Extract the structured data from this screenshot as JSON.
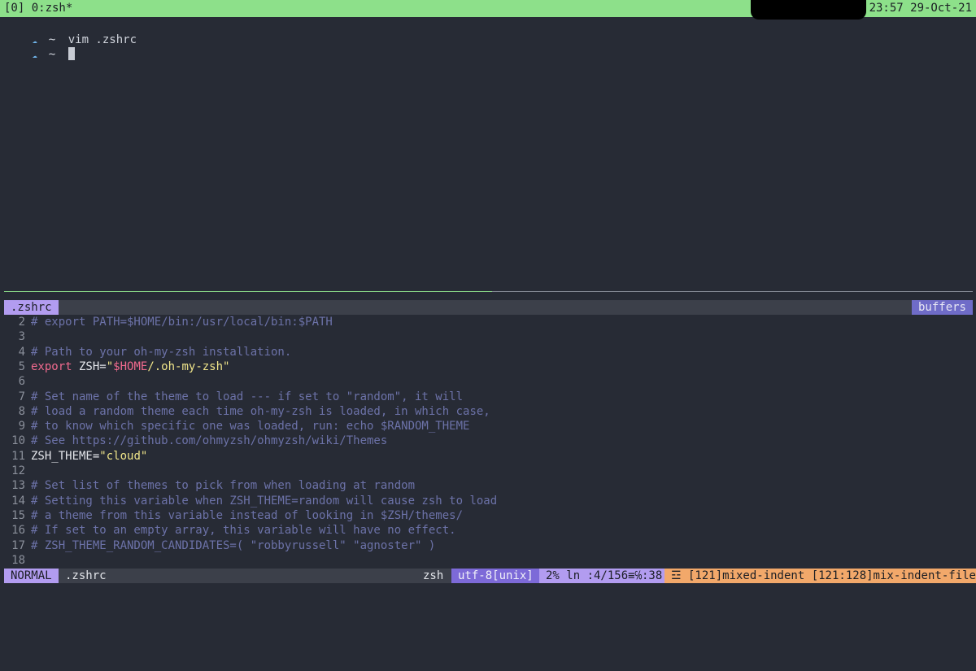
{
  "tmux": {
    "window_label": "[0] 0:zsh*",
    "clock": "23:57 29-Oct-21",
    "colors": {
      "bar": "#8de08a",
      "text": "#1b1e24"
    }
  },
  "shell": {
    "lines": [
      {
        "icon": "cloud-icon",
        "dir": "~",
        "command": "vim .zshrc"
      },
      {
        "icon": "cloud-icon",
        "dir": "~",
        "command": ""
      }
    ]
  },
  "vim": {
    "tabline": {
      "current_tab": ".zshrc",
      "buffers_label": "buffers"
    },
    "lines": [
      {
        "num": "2",
        "segments": [
          {
            "t": "# export PATH=$HOME/bin:/usr/local/bin:$PATH",
            "c": "comment"
          }
        ]
      },
      {
        "num": "3",
        "segments": []
      },
      {
        "num": "4",
        "segments": [
          {
            "t": "# Path to your oh-my-zsh installation.",
            "c": "comment"
          }
        ]
      },
      {
        "num": "5",
        "segments": [
          {
            "t": "export",
            "c": "kw"
          },
          {
            "t": " ZSH=",
            "c": "plain"
          },
          {
            "t": "\"",
            "c": "str"
          },
          {
            "t": "$HOME",
            "c": "var"
          },
          {
            "t": "/.oh-my-zsh\"",
            "c": "str"
          }
        ]
      },
      {
        "num": "6",
        "segments": []
      },
      {
        "num": "7",
        "segments": [
          {
            "t": "# Set name of the theme to load --- if set to \"random\", it will",
            "c": "comment"
          }
        ]
      },
      {
        "num": "8",
        "segments": [
          {
            "t": "# load a random theme each time oh-my-zsh is loaded, in which case,",
            "c": "comment"
          }
        ]
      },
      {
        "num": "9",
        "segments": [
          {
            "t": "# to know which specific one was loaded, run: echo $RANDOM_THEME",
            "c": "comment"
          }
        ]
      },
      {
        "num": "10",
        "segments": [
          {
            "t": "# See https://github.com/ohmyzsh/ohmyzsh/wiki/Themes",
            "c": "comment"
          }
        ]
      },
      {
        "num": "11",
        "segments": [
          {
            "t": "ZSH_THEME=",
            "c": "plain"
          },
          {
            "t": "\"cloud\"",
            "c": "str"
          }
        ]
      },
      {
        "num": "12",
        "segments": []
      },
      {
        "num": "13",
        "segments": [
          {
            "t": "# Set list of themes to pick from when loading at random",
            "c": "comment"
          }
        ]
      },
      {
        "num": "14",
        "segments": [
          {
            "t": "# Setting this variable when ZSH_THEME=random will cause zsh to load",
            "c": "comment"
          }
        ]
      },
      {
        "num": "15",
        "segments": [
          {
            "t": "# a theme from this variable instead of looking in $ZSH/themes/",
            "c": "comment"
          }
        ]
      },
      {
        "num": "16",
        "segments": [
          {
            "t": "# If set to an empty array, this variable will have no effect.",
            "c": "comment"
          }
        ]
      },
      {
        "num": "17",
        "segments": [
          {
            "t": "# ZSH_THEME_RANDOM_CANDIDATES=( \"robbyrussell\" \"agnoster\" )",
            "c": "comment"
          }
        ]
      },
      {
        "num": "18",
        "segments": []
      }
    ],
    "statusline": {
      "mode": "NORMAL",
      "filename": ".zshrc",
      "filetype": "zsh",
      "encoding": "utf-8[unix]",
      "position": "2% ln :4/156≡℅:38",
      "warning": "☲ [121]mixed-indent [121:128]mix-indent-file"
    },
    "colors": {
      "comment": "#6c72a8",
      "keyword": "#f06a8e",
      "string": "#f0e58a",
      "mode_bg": "#b29cf0",
      "warning_bg": "#f2a86a"
    }
  }
}
